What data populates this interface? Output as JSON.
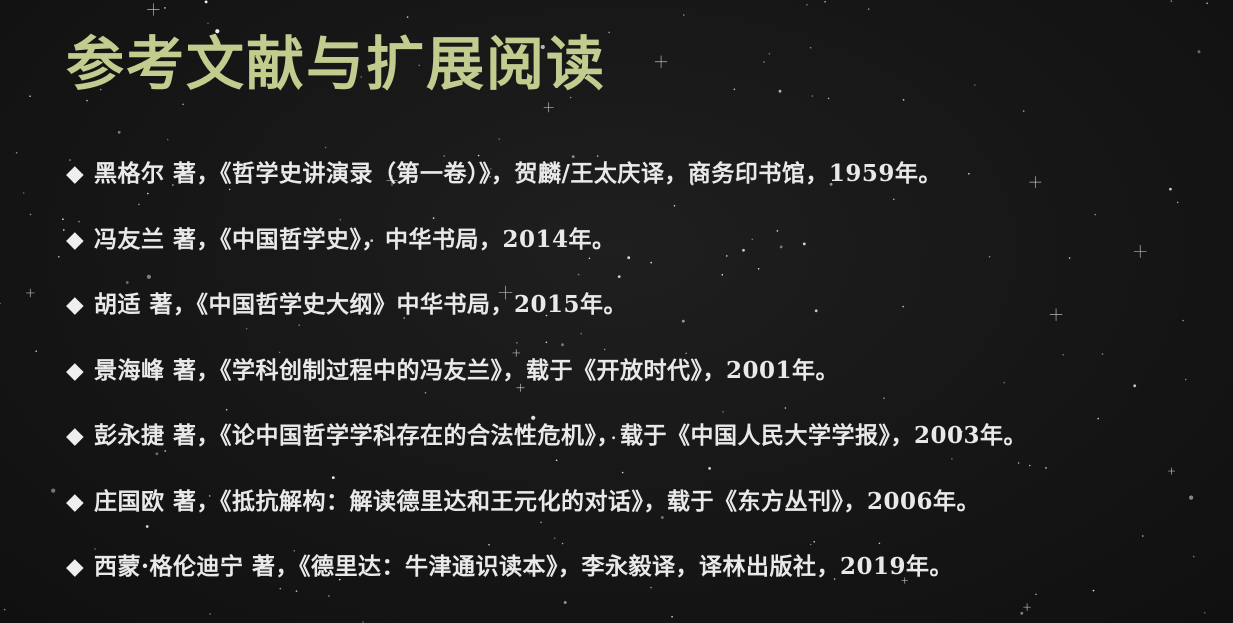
{
  "slide": {
    "title": "参考文献与扩展阅读",
    "title_color": "#c3cc8f",
    "bullet_symbol": "◆",
    "references": [
      "黑格尔 著，《哲学史讲演录（第一卷）》，贺麟/王太庆译，商务印书馆，1959年。",
      "冯友兰 著，《中国哲学史》，中华书局，2014年。",
      "胡适 著，《中国哲学史大纲》中华书局，2015年。",
      "景海峰 著，《学科创制过程中的冯友兰》，载于《开放时代》，2001年。",
      "彭永捷 著，《论中国哲学学科存在的合法性危机》，载于《中国人民大学学报》，2003年。",
      "庄国欧 著，《抵抗解构：解读德里达和王元化的对话》，载于《东方丛刊》，2006年。",
      "西蒙·格伦迪宁 著，《德里达：牛津通识读本》，李永毅译，译林出版社，2019年。"
    ]
  }
}
